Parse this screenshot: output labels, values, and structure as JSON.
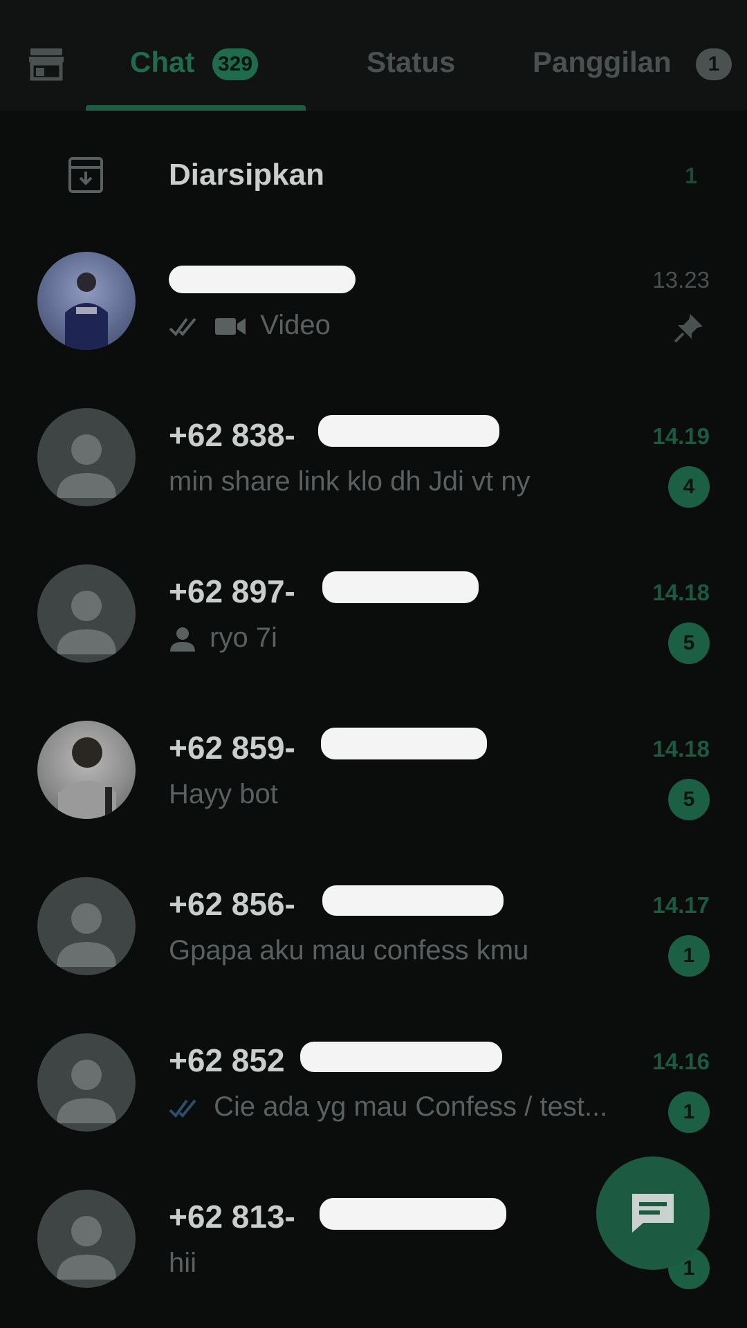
{
  "tabs": {
    "chat": {
      "label": "Chat",
      "badge": "329"
    },
    "status": {
      "label": "Status"
    },
    "calls": {
      "label": "Panggilan",
      "badge": "1"
    }
  },
  "archived": {
    "label": "Diarsipkan",
    "count": "1"
  },
  "chats": [
    {
      "name": "",
      "time": "13.23",
      "preview": "Video",
      "preview_icon": "video-icon",
      "ticks": "double-tick-icon",
      "pinned": true,
      "unread": "",
      "avatar": "photo"
    },
    {
      "name": "+62 838-",
      "time": "14.19",
      "preview": "min share link klo dh Jdi vt ny",
      "unread": "4",
      "avatar": "default"
    },
    {
      "name": "+62 897-",
      "time": "14.18",
      "preview": "ryo 7i",
      "preview_icon": "contact-icon",
      "unread": "5",
      "avatar": "default"
    },
    {
      "name": "+62 859-",
      "time": "14.18",
      "preview": "Hayy bot",
      "unread": "5",
      "avatar": "photo"
    },
    {
      "name": "+62 856-",
      "time": "14.17",
      "preview": "Gpapa aku mau confess kmu",
      "unread": "1",
      "avatar": "default"
    },
    {
      "name": "+62 852",
      "time": "14.16",
      "preview": "Cie ada yg mau Confess / test...",
      "ticks": "double-tick-icon",
      "unread": "1",
      "avatar": "default"
    },
    {
      "name": "+62 813-",
      "time": "",
      "preview": "hii",
      "unread": "1",
      "avatar": "default"
    }
  ],
  "colors": {
    "accent": "#1f6b4e",
    "background": "#0b0c0c",
    "topbar": "#111312"
  }
}
